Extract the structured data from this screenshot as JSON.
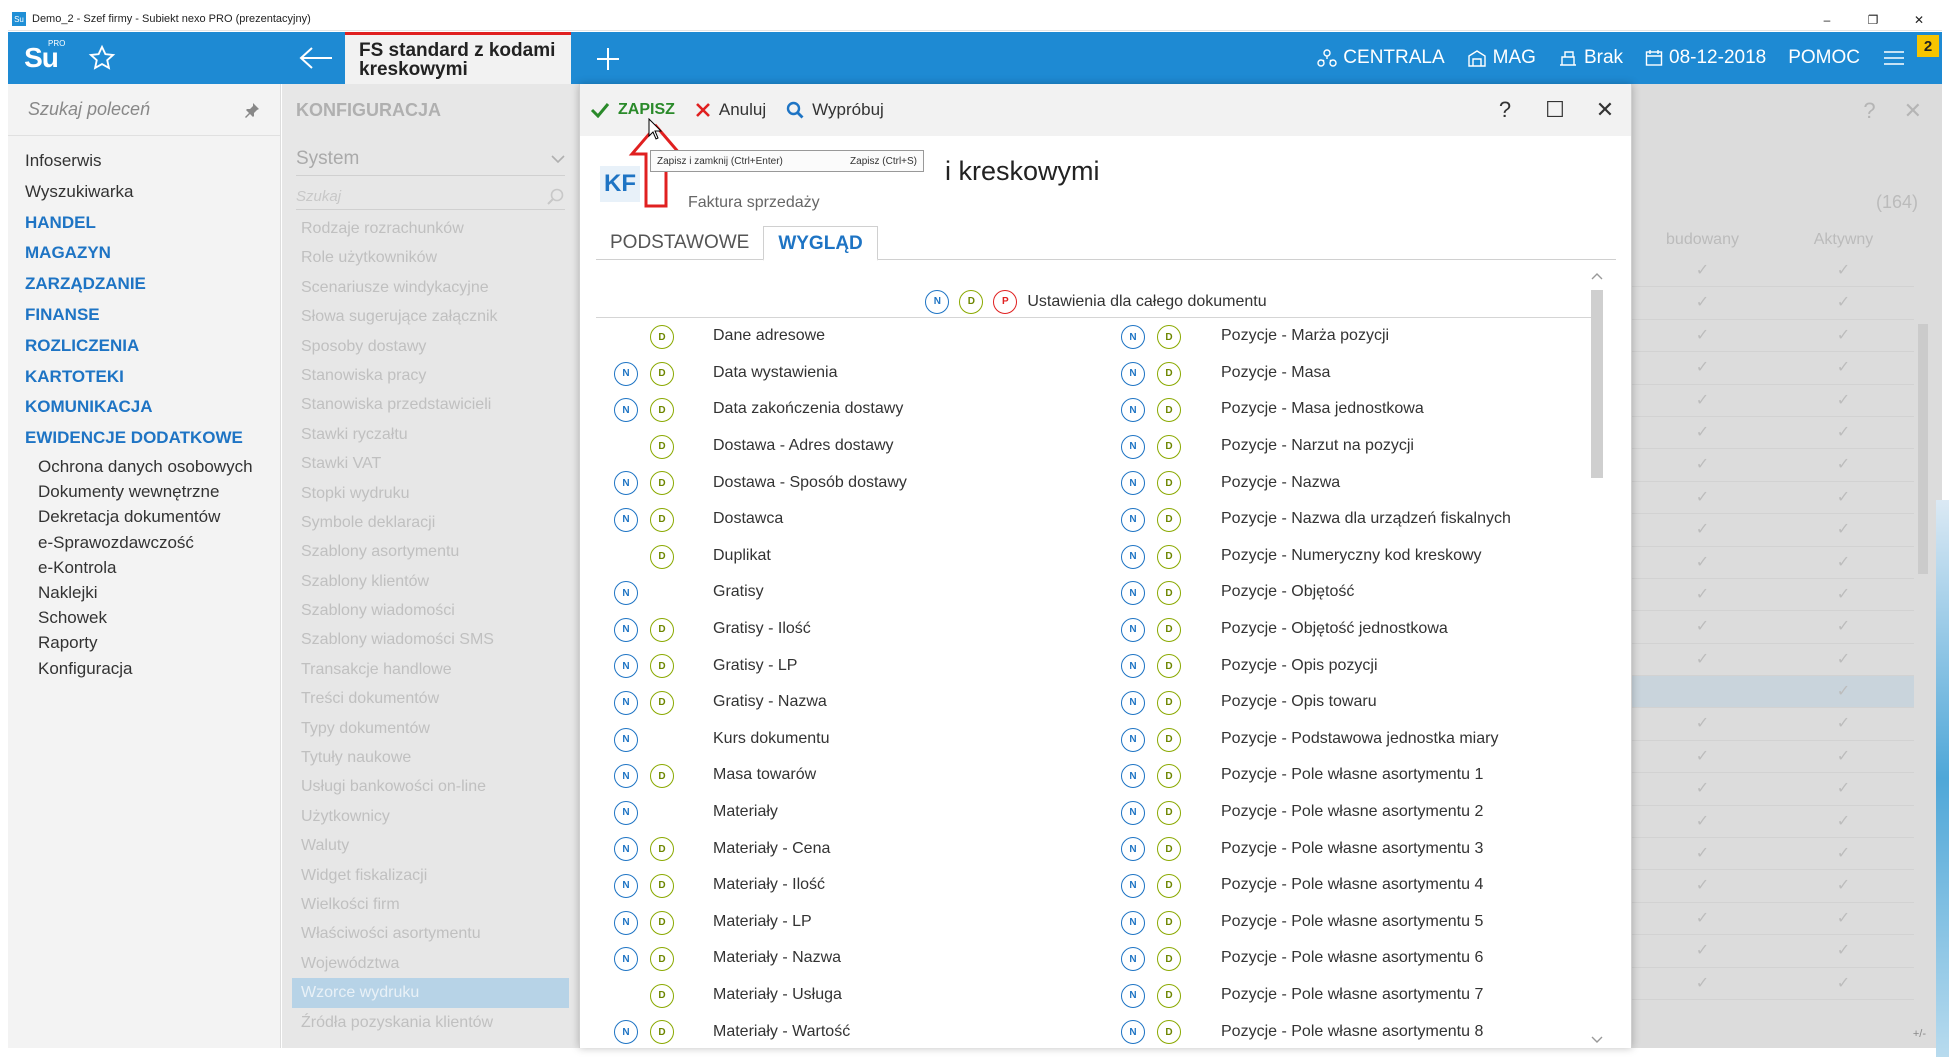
{
  "window": {
    "title": "Demo_2 - Szef firmy - Subiekt nexo PRO (prezentacyjny)",
    "min": "–",
    "restore": "❐",
    "close": "✕"
  },
  "topbar": {
    "logo": "Su",
    "logo_sup": "PRO",
    "active_tab": "FS standard z kodami kreskowymi",
    "nav": [
      "CENTRALA",
      "MAG",
      "Brak",
      "08-12-2018",
      "POMOC"
    ],
    "badge": "2",
    "accent": "#1e8ad3"
  },
  "sidebar": {
    "search_placeholder": "Szukaj poleceń",
    "items": [
      {
        "label": "Infoserwis",
        "kind": "plain"
      },
      {
        "label": "Wyszukiwarka",
        "kind": "plain"
      },
      {
        "label": "HANDEL",
        "kind": "cap"
      },
      {
        "label": "MAGAZYN",
        "kind": "cap"
      },
      {
        "label": "ZARZĄDZANIE",
        "kind": "cap"
      },
      {
        "label": "FINANSE",
        "kind": "cap"
      },
      {
        "label": "ROZLICZENIA",
        "kind": "cap"
      },
      {
        "label": "KARTOTEKI",
        "kind": "cap"
      },
      {
        "label": "KOMUNIKACJA",
        "kind": "cap"
      },
      {
        "label": "EWIDENCJE DODATKOWE",
        "kind": "cap"
      },
      {
        "label": "Ochrona danych osobowych",
        "kind": "sub"
      },
      {
        "label": "Dokumenty wewnętrzne",
        "kind": "sub"
      },
      {
        "label": "Dekretacja dokumentów",
        "kind": "sub"
      },
      {
        "label": "e-Sprawozdawczość",
        "kind": "sub"
      },
      {
        "label": "e-Kontrola",
        "kind": "sub"
      },
      {
        "label": "Naklejki",
        "kind": "sub"
      },
      {
        "label": "Schowek",
        "kind": "sub"
      },
      {
        "label": "Raporty",
        "kind": "sub"
      },
      {
        "label": "Konfiguracja",
        "kind": "sub"
      }
    ]
  },
  "config": {
    "title": "KONFIGURACJA",
    "section": "System",
    "search_placeholder": "Szukaj",
    "items": [
      "Rodzaje rozrachunków",
      "Role użytkowników",
      "Scenariusze windykacyjne",
      "Słowa sugerujące załącznik",
      "Sposoby dostawy",
      "Stanowiska pracy",
      "Stanowiska przedstawicieli",
      "Stawki ryczałtu",
      "Stawki VAT",
      "Stopki wydruku",
      "Symbole deklaracji",
      "Szablony asortymentu",
      "Szablony klientów",
      "Szablony wiadomości",
      "Szablony wiadomości SMS",
      "Transakcje handlowe",
      "Treści dokumentów",
      "Typy dokumentów",
      "Tytuły naukowe",
      "Usługi bankowości on-line",
      "Użytkownicy",
      "Waluty",
      "Widget fiskalizacji",
      "Wielkości firm",
      "Właściwości asortymentu",
      "Województwa",
      "Wzorce wydruku",
      "Źródła pozyskania klientów"
    ],
    "selected_index": 26
  },
  "bgpanel": {
    "count": "(164)",
    "col1": "budowany",
    "col2": "Aktywny",
    "check": "✓",
    "rows": 23,
    "highlight_row": 13,
    "pm": "+/-"
  },
  "dialog": {
    "toolbar": {
      "save": "ZAPISZ",
      "cancel": "Anuluj",
      "try": "Wypróbuj",
      "help": "?",
      "max": "☐",
      "close": "✕"
    },
    "tooltip_left": "Zapisz i zamknij (Ctrl+Enter)",
    "tooltip_right": "Zapisz (Ctrl+S)",
    "kf": "KF",
    "title": "i kreskowymi",
    "subtitle": "Faktura sprzedaży",
    "tabs": [
      "PODSTAWOWE",
      "WYGLĄD"
    ],
    "active_tab": 1,
    "group_header": "Ustawienia dla całego dokumentu",
    "letters": {
      "n": "N",
      "d": "D",
      "p": "P"
    },
    "left": [
      {
        "label": "Dane adresowe",
        "n": false,
        "d": true
      },
      {
        "label": "Data wystawienia",
        "n": true,
        "d": true
      },
      {
        "label": "Data zakończenia dostawy",
        "n": true,
        "d": true
      },
      {
        "label": "Dostawa - Adres dostawy",
        "n": false,
        "d": true
      },
      {
        "label": "Dostawa - Sposób dostawy",
        "n": true,
        "d": true
      },
      {
        "label": "Dostawca",
        "n": true,
        "d": true
      },
      {
        "label": "Duplikat",
        "n": false,
        "d": true
      },
      {
        "label": "Gratisy",
        "n": true,
        "d": false
      },
      {
        "label": "Gratisy - Ilość",
        "n": true,
        "d": true
      },
      {
        "label": "Gratisy - LP",
        "n": true,
        "d": true
      },
      {
        "label": "Gratisy - Nazwa",
        "n": true,
        "d": true
      },
      {
        "label": "Kurs dokumentu",
        "n": true,
        "d": false
      },
      {
        "label": "Masa towarów",
        "n": true,
        "d": true
      },
      {
        "label": "Materiały",
        "n": true,
        "d": false
      },
      {
        "label": "Materiały - Cena",
        "n": true,
        "d": true
      },
      {
        "label": "Materiały - Ilość",
        "n": true,
        "d": true
      },
      {
        "label": "Materiały - LP",
        "n": true,
        "d": true
      },
      {
        "label": "Materiały - Nazwa",
        "n": true,
        "d": true
      },
      {
        "label": "Materiały - Usługa",
        "n": false,
        "d": true
      },
      {
        "label": "Materiały - Wartość",
        "n": true,
        "d": true
      }
    ],
    "right": [
      "Pozycje - Marża pozycji",
      "Pozycje - Masa",
      "Pozycje - Masa jednostkowa",
      "Pozycje - Narzut na pozycji",
      "Pozycje - Nazwa",
      "Pozycje - Nazwa dla urządzeń fiskalnych",
      "Pozycje - Numeryczny kod kreskowy",
      "Pozycje - Objętość",
      "Pozycje - Objętość jednostkowa",
      "Pozycje - Opis pozycji",
      "Pozycje - Opis towaru",
      "Pozycje - Podstawowa jednostka miary",
      "Pozycje - Pole własne asortymentu 1",
      "Pozycje - Pole własne asortymentu 2",
      "Pozycje - Pole własne asortymentu 3",
      "Pozycje - Pole własne asortymentu 4",
      "Pozycje - Pole własne asortymentu 5",
      "Pozycje - Pole własne asortymentu 6",
      "Pozycje - Pole własne asortymentu 7",
      "Pozycje - Pole własne asortymentu 8"
    ]
  }
}
